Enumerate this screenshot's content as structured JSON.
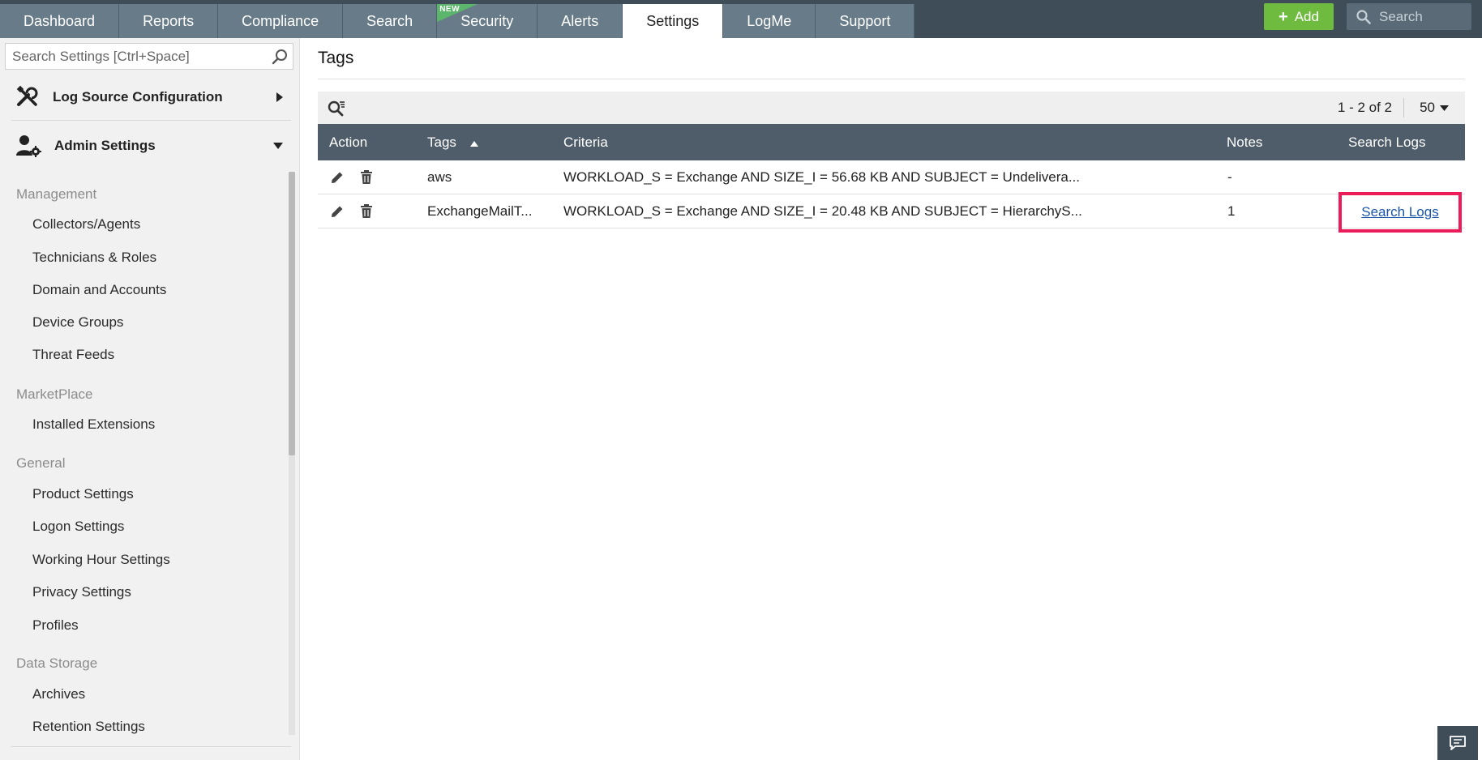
{
  "nav": {
    "tabs": [
      {
        "label": "Dashboard"
      },
      {
        "label": "Reports"
      },
      {
        "label": "Compliance"
      },
      {
        "label": "Search"
      },
      {
        "label": "Security",
        "badge": "NEW"
      },
      {
        "label": "Alerts"
      },
      {
        "label": "Settings",
        "active": true
      },
      {
        "label": "LogMe"
      },
      {
        "label": "Support"
      }
    ],
    "add_label": "Add",
    "search_placeholder": "Search"
  },
  "sidebar": {
    "search_placeholder": "Search Settings [Ctrl+Space]",
    "groups": [
      {
        "label": "Log Source Configuration",
        "expanded": false
      },
      {
        "label": "Admin Settings",
        "expanded": true
      }
    ],
    "sections": [
      {
        "label": "Management",
        "items": [
          "Collectors/Agents",
          "Technicians & Roles",
          "Domain and Accounts",
          "Device Groups",
          "Threat Feeds"
        ]
      },
      {
        "label": "MarketPlace",
        "items": [
          "Installed Extensions"
        ]
      },
      {
        "label": "General",
        "items": [
          "Product Settings",
          "Logon Settings",
          "Working Hour Settings",
          "Privacy Settings",
          "Profiles"
        ]
      },
      {
        "label": "Data Storage",
        "items": [
          "Archives",
          "Retention Settings"
        ]
      }
    ]
  },
  "main": {
    "title": "Tags",
    "pager": "1 - 2 of 2",
    "per_page": "50",
    "columns": {
      "action": "Action",
      "tags": "Tags",
      "criteria": "Criteria",
      "notes": "Notes",
      "search_logs": "Search Logs"
    },
    "rows": [
      {
        "tag": "aws",
        "criteria": "WORKLOAD_S = Exchange AND SIZE_I = 56.68 KB AND SUBJECT = Undelivera...",
        "notes": "-",
        "search_link": ""
      },
      {
        "tag": "ExchangeMailT...",
        "criteria": "WORKLOAD_S = Exchange AND SIZE_I = 20.48 KB AND SUBJECT = HierarchyS...",
        "notes": "1",
        "search_link": "Search Logs"
      }
    ]
  },
  "colors": {
    "topbar": "#3f4d59",
    "tab": "#687b88",
    "add": "#6fbb3f",
    "table_header": "#4e5d69",
    "highlight": "#ec1b5a",
    "link": "#1a56a8"
  }
}
